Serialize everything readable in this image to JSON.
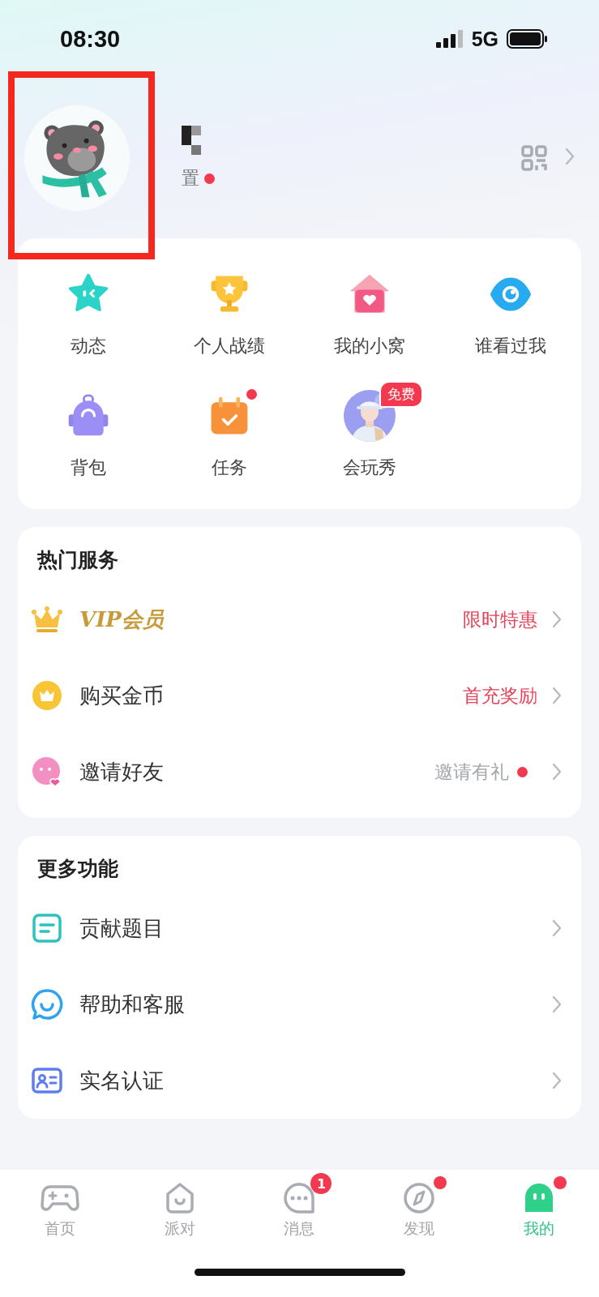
{
  "status_bar": {
    "time": "08:30",
    "network": "5G"
  },
  "profile": {
    "subtitle": "置",
    "subtitle_dot": true,
    "highlight_frame": true
  },
  "shortcuts": [
    {
      "label": "动态",
      "dot": false
    },
    {
      "label": "个人战绩",
      "dot": false
    },
    {
      "label": "我的小窝",
      "dot": false
    },
    {
      "label": "谁看过我",
      "dot": false
    },
    {
      "label": "背包",
      "dot": false
    },
    {
      "label": "任务",
      "dot": true
    },
    {
      "label": "会玩秀",
      "dot": false,
      "badge": "免费"
    }
  ],
  "hot_services": {
    "title": "热门服务",
    "items": [
      {
        "kind": "vip",
        "label": "VIP会员",
        "value": "限时特惠",
        "highlight": true,
        "dot": false
      },
      {
        "kind": "normal",
        "label": "购买金币",
        "value": "首充奖励",
        "highlight": true,
        "dot": false
      },
      {
        "kind": "normal",
        "label": "邀请好友",
        "value": "邀请有礼",
        "highlight": false,
        "dot": true
      }
    ]
  },
  "more_features": {
    "title": "更多功能",
    "items": [
      {
        "label": "贡献题目"
      },
      {
        "label": "帮助和客服"
      },
      {
        "label": "实名认证"
      }
    ]
  },
  "tab_bar": [
    {
      "label": "首页",
      "selected": false
    },
    {
      "label": "派对",
      "selected": false
    },
    {
      "label": "消息",
      "selected": false,
      "badge": "1"
    },
    {
      "label": "发现",
      "selected": false,
      "dot": true
    },
    {
      "label": "我的",
      "selected": true,
      "dot": true
    }
  ]
}
